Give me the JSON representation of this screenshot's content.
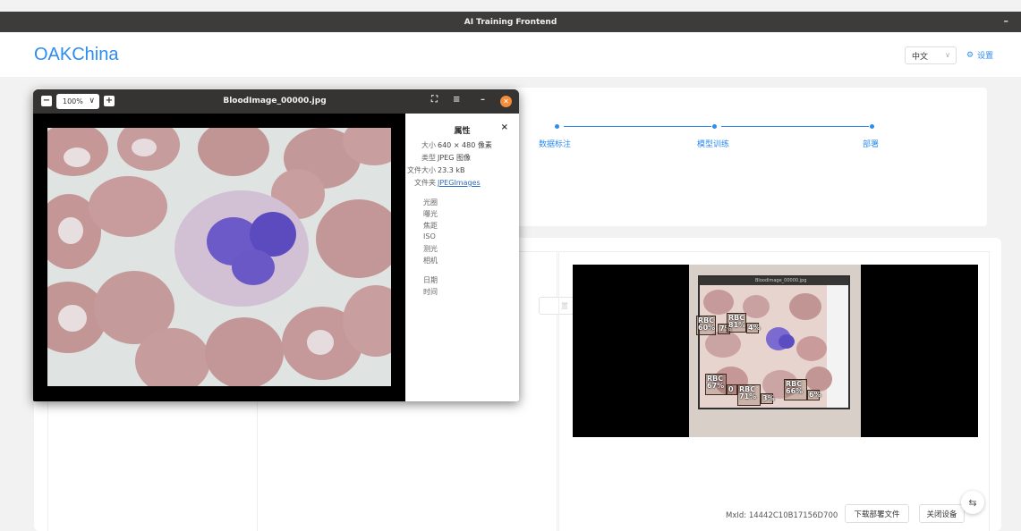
{
  "os_window": {
    "title": "AI Training Frontend",
    "minimize": "–"
  },
  "header": {
    "brand": "OAKChina",
    "language": "中文",
    "settings_label": "设置"
  },
  "steps": [
    {
      "label": "数据标注"
    },
    {
      "label": "模型训练"
    },
    {
      "label": "部署"
    }
  ],
  "deploy": {
    "ghost_button": "置",
    "mxid": "MxId: 14442C10B17156D700",
    "download_button": "下载部署文件",
    "close_device_button": "关闭设备",
    "detections": [
      {
        "label": "RBC",
        "score": "60%"
      },
      {
        "label": "RBC",
        "score": "81%"
      },
      {
        "label": "",
        "score": "7%"
      },
      {
        "label": "",
        "score": "4%"
      },
      {
        "label": "RBC",
        "score": "67%"
      },
      {
        "label": "RBC",
        "score": "71%"
      },
      {
        "label": "RBC",
        "score": "66%"
      },
      {
        "label": "",
        "score": "3%"
      },
      {
        "label": "",
        "score": "6%"
      },
      {
        "label": "",
        "score": "0"
      }
    ],
    "camera_titlebar": "Bloodimage_00000.jpg"
  },
  "viewer": {
    "zoom": "100%",
    "title": "BloodImage_00000.jpg",
    "properties": {
      "title": "属性",
      "close": "×",
      "rows": [
        {
          "key": "大小",
          "value": "640 × 480 像素"
        },
        {
          "key": "类型",
          "value": "JPEG 图像"
        },
        {
          "key": "文件大小",
          "value": "23.3 kB"
        },
        {
          "key": "文件夹",
          "value": "JPEGImages"
        }
      ],
      "exif_labels": [
        "光圈",
        "曝光",
        "焦距",
        "ISO",
        "测光",
        "相机"
      ],
      "date_labels": [
        "日期",
        "时间"
      ]
    }
  },
  "colors": {
    "accent": "#2d8cf0",
    "viewer_close": "#f58c3a"
  }
}
